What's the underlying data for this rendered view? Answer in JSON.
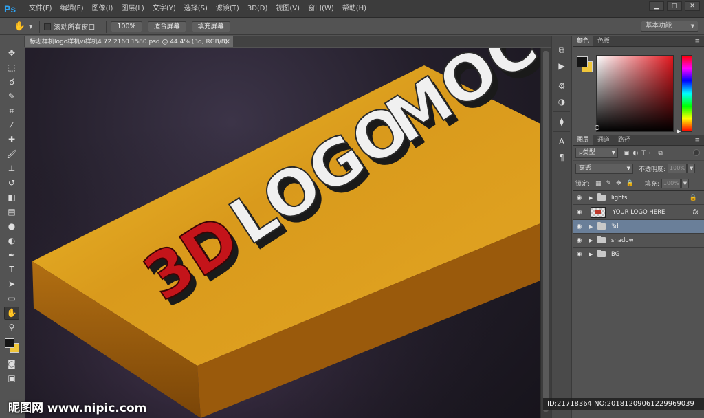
{
  "app": {
    "logo": "Ps"
  },
  "menu": [
    "文件(F)",
    "编辑(E)",
    "图像(I)",
    "图层(L)",
    "文字(Y)",
    "选择(S)",
    "滤镜(T)",
    "3D(D)",
    "视图(V)",
    "窗口(W)",
    "帮助(H)"
  ],
  "window": {
    "minimize": "▁",
    "restore": "□",
    "close": "✕"
  },
  "options": {
    "scroll_all_label": "滚动所有窗口",
    "zoom_100": "100%",
    "fit_screen": "适合屏幕",
    "fill_screen": "填充屏幕",
    "workspace": "基本功能"
  },
  "document": {
    "tab_title": "标志样机logo样机vi样机4 72 2160 1580.psd @ 44.4% (3d, RGB/8)",
    "tab_close": "×"
  },
  "artwork": {
    "text_3d": "3D",
    "text_logo": "LOGO",
    "text_mock": "MOCK"
  },
  "colors": {
    "foreground": "#151515",
    "background": "#f0c63a",
    "selected_layer": "#6a7f99",
    "text_3d": "#c4141a",
    "block_top": "#e0a321"
  },
  "color_panel": {
    "tabs": [
      "颜色",
      "色板"
    ]
  },
  "layers_panel": {
    "tabs": [
      "图层",
      "通道",
      "路径"
    ],
    "kind_filter": "ρ类型",
    "blend_mode": "穿透",
    "opacity_label": "不透明度:",
    "opacity_value": "100%",
    "lock_label": "锁定:",
    "fill_label": "填充:",
    "fill_value": "100%",
    "layers": [
      {
        "name": "lights",
        "type": "group",
        "locked": true
      },
      {
        "name": "YOUR LOGO HERE",
        "type": "smart-object",
        "fx": "fx"
      },
      {
        "name": "3d",
        "type": "group",
        "selected": true
      },
      {
        "name": "shadow",
        "type": "group"
      },
      {
        "name": "BG",
        "type": "group"
      }
    ]
  },
  "watermark": {
    "left": "昵图网 www.nipic.com",
    "right": "ID:21718364 NO:20181209061229969039"
  }
}
